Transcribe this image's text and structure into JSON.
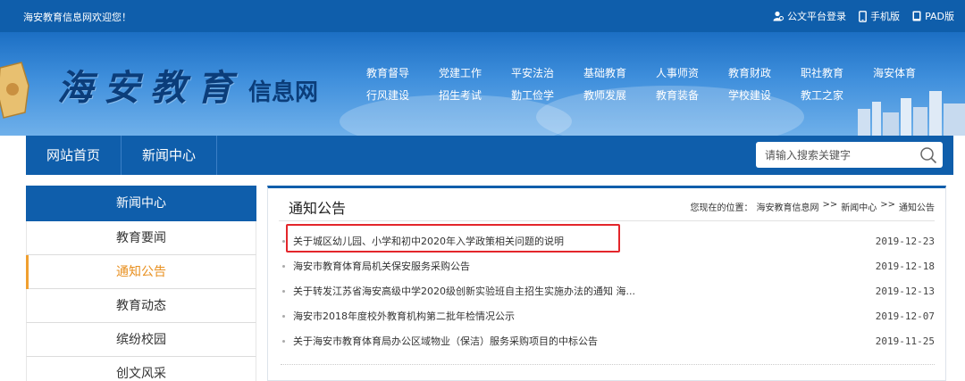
{
  "topbar": {
    "welcome": "海安教育信息网欢迎您！",
    "links": [
      {
        "label": "公文平台登录",
        "icon": "user-icon"
      },
      {
        "label": "手机版",
        "icon": "mobile-icon"
      },
      {
        "label": "PAD版",
        "icon": "tablet-icon"
      }
    ]
  },
  "logo": {
    "main": "海安教育",
    "sub": "信息网"
  },
  "banner_nav": {
    "row1": [
      "教育督导",
      "党建工作",
      "平安法治",
      "基础教育",
      "人事师资",
      "教育财政",
      "职社教育",
      "海安体育"
    ],
    "row2": [
      "行风建设",
      "招生考试",
      "勤工俭学",
      "教师发展",
      "教育装备",
      "学校建设",
      "教工之家"
    ]
  },
  "mainnav": {
    "items": [
      "网站首页",
      "新闻中心"
    ],
    "search_placeholder": "请输入搜索关键字"
  },
  "sidebar": {
    "header": "新闻中心",
    "items": [
      "教育要闻",
      "通知公告",
      "教育动态",
      "缤纷校园",
      "创文风采"
    ],
    "active": "通知公告"
  },
  "content": {
    "title": "通知公告",
    "breadcrumb": {
      "prefix": "您现在的位置：",
      "parts": [
        "海安教育信息网",
        ">>",
        "新闻中心",
        ">>",
        "通知公告"
      ]
    },
    "news": [
      {
        "title": "关于城区幼儿园、小学和初中2020年入学政策相关问题的说明",
        "date": "2019-12-23"
      },
      {
        "title": "海安市教育体育局机关保安服务采购公告",
        "date": "2019-12-18"
      },
      {
        "title": "关于转发江苏省海安高级中学2020级创新实验班自主招生实施办法的通知 海...",
        "date": "2019-12-13"
      },
      {
        "title": "海安市2018年度校外教育机构第二批年检情况公示",
        "date": "2019-12-07"
      },
      {
        "title": "关于海安市教育体育局办公区域物业（保洁）服务采购项目的中标公告",
        "date": "2019-11-25"
      }
    ]
  },
  "colors": {
    "primary": "#0f5eab",
    "active": "#e89020",
    "highlight": "#e3262b"
  }
}
